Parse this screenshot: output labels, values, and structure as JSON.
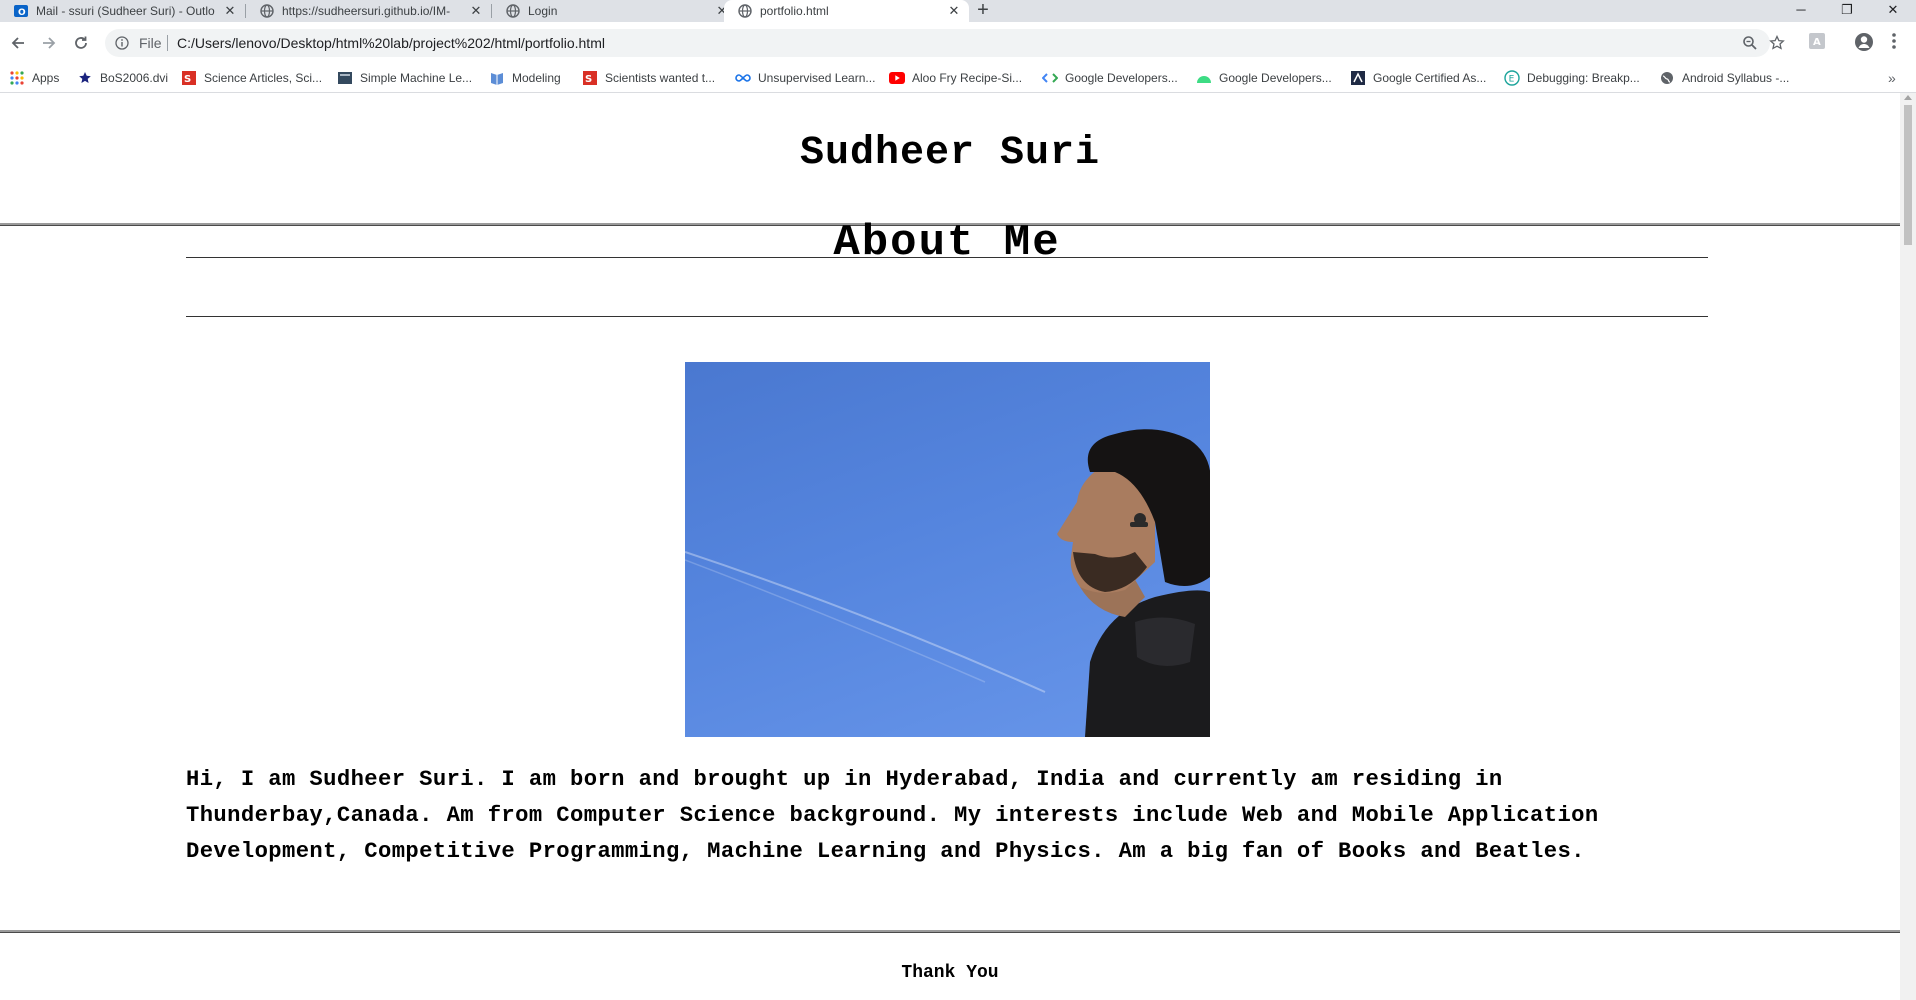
{
  "browser": {
    "tabs": [
      {
        "label": "Mail - ssuri (Sudheer Suri) - Outlo",
        "icon": "outlook-icon",
        "active": false
      },
      {
        "label": "https://sudheersuri.github.io/IM-",
        "icon": "globe-icon",
        "active": false
      },
      {
        "label": "Login",
        "icon": "globe-icon",
        "active": false
      },
      {
        "label": "portfolio.html",
        "icon": "globe-icon",
        "active": true
      }
    ],
    "new_tab_label": "+",
    "file_label": "File",
    "url": "C:/Users/lenovo/Desktop/html%20lab/project%202/html/portfolio.html",
    "bookmarks": [
      {
        "label": "Apps",
        "icon": "apps-grid-icon"
      },
      {
        "label": "BoS2006.dvi",
        "icon": "star-icon"
      },
      {
        "label": "Science Articles, Sci...",
        "icon": "science-icon"
      },
      {
        "label": "Simple Machine Le...",
        "icon": "page-icon"
      },
      {
        "label": "Modeling",
        "icon": "book-icon"
      },
      {
        "label": "Scientists wanted t...",
        "icon": "science-icon"
      },
      {
        "label": "Unsupervised Learn...",
        "icon": "infinity-icon"
      },
      {
        "label": "Aloo Fry Recipe-Si...",
        "icon": "youtube-icon"
      },
      {
        "label": "Google Developers...",
        "icon": "code-icon"
      },
      {
        "label": "Google Developers...",
        "icon": "android-icon"
      },
      {
        "label": "Google Certified As...",
        "icon": "badge-icon"
      },
      {
        "label": "Debugging: Breakp...",
        "icon": "e-icon"
      },
      {
        "label": "Android Syllabus -...",
        "icon": "globe-icon"
      }
    ],
    "bookmarks_overflow": "»"
  },
  "page": {
    "site_name": "Sudheer Suri",
    "section_title": "About Me",
    "bio": "Hi, I am Sudheer Suri. I am born and brought up in Hyderabad, India and currently am residing in Thunderbay,Canada. Am from Computer Science background. My interests include Web and Mobile Application Development, Competitive Programming, Machine Learning and Physics. Am a big fan of Books and Beatles.",
    "footer": "Thank You"
  },
  "colors": {
    "tabstrip": "#dee1e6",
    "omnibox": "#f1f3f4",
    "sky": "#5585de"
  }
}
